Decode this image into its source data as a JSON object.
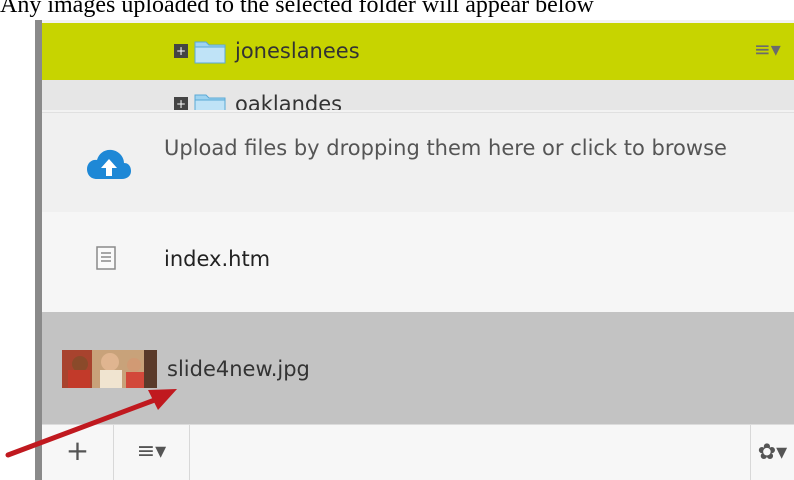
{
  "caption": "Any images uploaded to the selected folder will appear below",
  "folders": [
    {
      "name": "joneslanees",
      "expand_symbol": "+",
      "menu_symbol": "≡▾"
    },
    {
      "name": "oaklandes",
      "expand_symbol": "+"
    }
  ],
  "upload": {
    "text": "Upload files by dropping them here or click to browse",
    "icon": "cloud-upload-icon"
  },
  "files": [
    {
      "name": "index.htm",
      "icon": "document-icon"
    },
    {
      "name": "slide4new.jpg",
      "icon": "image-thumbnail",
      "selected": true
    }
  ],
  "toolbar": {
    "add_symbol": "+",
    "menu_symbol": "≡▾",
    "settings_symbol": "✿▾"
  },
  "colors": {
    "selected_folder": "#c7d400",
    "selected_file": "#c3c3c3",
    "arrow": "#c0191f",
    "cloud": "#1e88d6"
  }
}
